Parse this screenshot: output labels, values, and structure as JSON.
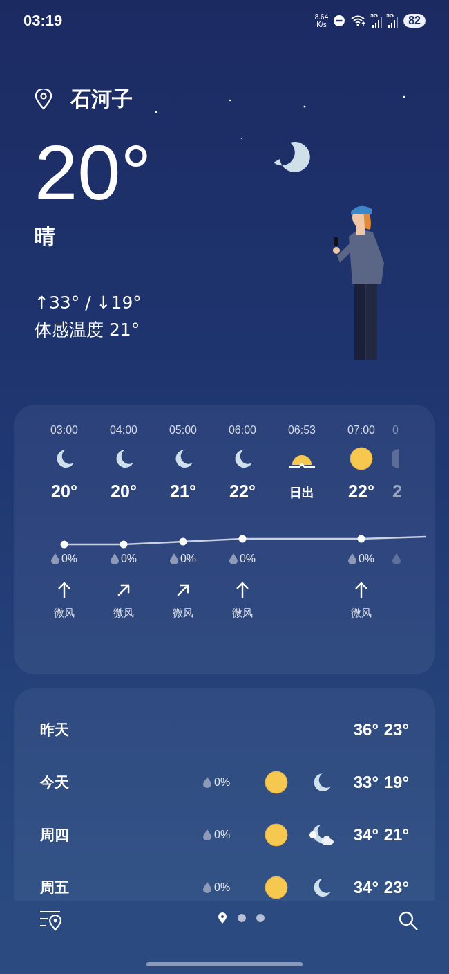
{
  "status_bar": {
    "time": "03:19",
    "net_speed": "8.64",
    "net_unit": "K/s",
    "signal_labels": [
      "5G",
      "5G"
    ],
    "battery": "82"
  },
  "location": {
    "name": "石河子"
  },
  "current": {
    "temp": "20°",
    "condition": "晴",
    "high_low": "↑33° / ↓19°",
    "feels_like": "体感温度 21°"
  },
  "hourly": [
    {
      "kind": "moon",
      "time": "03:00",
      "temp": "20°",
      "precip": "0%",
      "wind_arrow": {
        "kind": "north"
      },
      "wind": "微风"
    },
    {
      "kind": "moon",
      "time": "04:00",
      "temp": "20°",
      "precip": "0%",
      "wind_arrow": {
        "kind": "northeast"
      },
      "wind": "微风"
    },
    {
      "kind": "moon",
      "time": "05:00",
      "temp": "21°",
      "precip": "0%",
      "wind_arrow": {
        "kind": "northeast"
      },
      "wind": "微风"
    },
    {
      "kind": "moon",
      "time": "06:00",
      "temp": "22°",
      "precip": "0%",
      "wind_arrow": {
        "kind": "north"
      },
      "wind": "微风"
    },
    {
      "kind": "sunrise",
      "time": "06:53",
      "temp": "日出"
    },
    {
      "kind": "sun",
      "time": "07:00",
      "temp": "22°",
      "precip": "0%",
      "wind_arrow": {
        "kind": "north"
      },
      "wind": "微风"
    },
    {
      "kind": "partial",
      "time": "0",
      "temp": "2"
    }
  ],
  "daily": [
    {
      "day": "昨天",
      "high": "36°",
      "low": "23°"
    },
    {
      "day": "今天",
      "precip": "0%",
      "icons": [
        {
          "kind": "sun"
        },
        {
          "kind": "moon"
        }
      ],
      "high": "33°",
      "low": "19°"
    },
    {
      "day": "周四",
      "precip": "0%",
      "icons": [
        {
          "kind": "sun"
        },
        {
          "kind": "moon-cloud"
        }
      ],
      "high": "34°",
      "low": "21°"
    },
    {
      "day": "周五",
      "precip": "0%",
      "icons": [
        {
          "kind": "sun"
        },
        {
          "kind": "moon"
        }
      ],
      "high": "34°",
      "low": "23°"
    }
  ],
  "pages": [
    {
      "kind": "location",
      "selected": true
    },
    {
      "kind": "dot",
      "selected": false
    },
    {
      "kind": "dot",
      "selected": false
    }
  ]
}
